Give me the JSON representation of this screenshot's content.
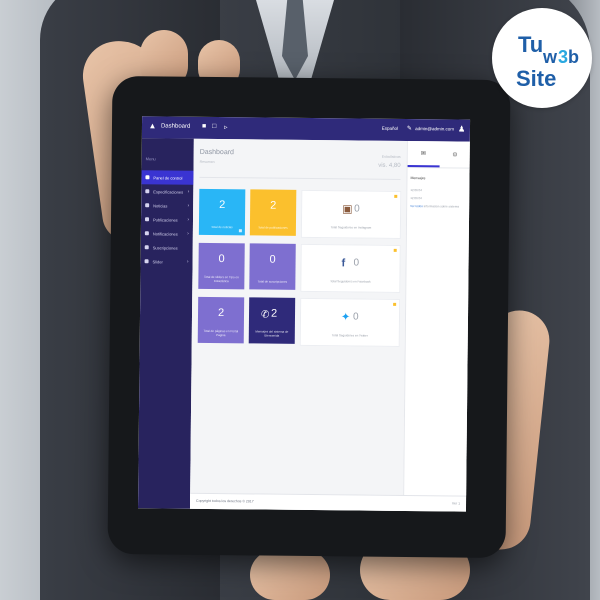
{
  "logo": {
    "text": "Tuw3bSite"
  },
  "dashboard": {
    "brand": "Dashboard",
    "topbar": {
      "language": "Español",
      "user": "admin@admin.com"
    },
    "sidebar": {
      "heading": "Menu",
      "items": [
        {
          "label": "Panel de control",
          "active": true
        },
        {
          "label": "Especificaciones",
          "chevron": true
        },
        {
          "label": "Noticias",
          "chevron": true
        },
        {
          "label": "Publicaciones",
          "chevron": true
        },
        {
          "label": "Notificaciones",
          "chevron": true
        },
        {
          "label": "Suscripciones"
        },
        {
          "label": "Slider",
          "chevron": true
        }
      ]
    },
    "header": {
      "title": "Dashboard",
      "subtitle": "Resumen",
      "metric_label": "Estadísticas",
      "metric_value": "vis. 4,80"
    },
    "cards": [
      {
        "value": "2",
        "label": "Total de noticias",
        "color": "#29b6f6"
      },
      {
        "value": "2",
        "label": "Total de publicaciones",
        "color": "#fbc02d"
      },
      {
        "value": "0",
        "label": "Total de sliders en Tipo en Estadística",
        "color": "#7e6fd0"
      },
      {
        "value": "0",
        "label": "Total de suscripciones",
        "color": "#7e6fd0"
      },
      {
        "value": "2",
        "label": "Total de páginas en Portal Pagina",
        "color": "#7e6fd0"
      },
      {
        "value": "2",
        "label": "Mensajes del sistema de Bienvenida",
        "color": "#2f2a7a"
      }
    ],
    "social": [
      {
        "icon": "instagram-icon",
        "value": "0",
        "label": "Total Seguidores en Instagram"
      },
      {
        "icon": "facebook-icon",
        "value": "0",
        "label": "Total Seguidores en Facebook"
      },
      {
        "icon": "twitter-icon",
        "value": "0",
        "label": "Total Seguidores en Twitter"
      }
    ],
    "panel": {
      "title": "Mensajes",
      "lines": [
        "12:06:04",
        "12:06:04",
        "Información sobre sistema"
      ],
      "link": "Ver todos"
    },
    "footer": {
      "left": "Copyright todos los derechos © 2017",
      "right": "Ver 1"
    }
  }
}
